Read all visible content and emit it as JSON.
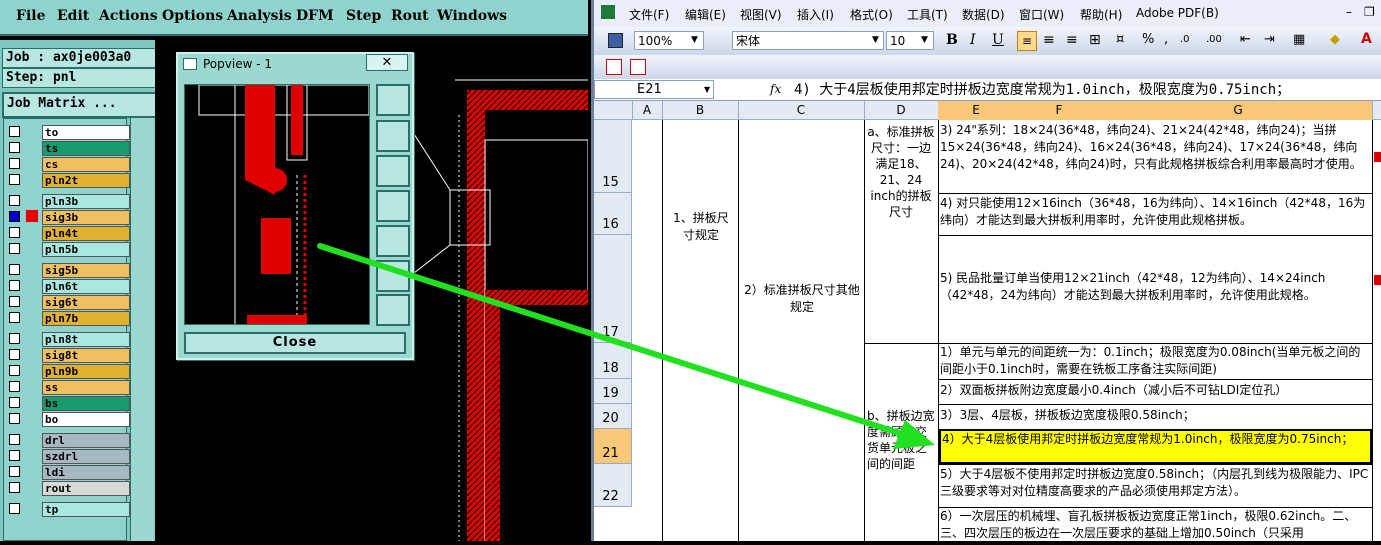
{
  "cam": {
    "menu": [
      "File",
      "Edit",
      "Actions",
      "Options",
      "Analysis",
      "DFM",
      "Step",
      "Rout",
      "Windows"
    ],
    "job": "Job : ax0je003a0",
    "step": "Step: pnl",
    "job_matrix": "Job Matrix ...",
    "layers": [
      {
        "name": "to",
        "color": "#ffffff",
        "on": false
      },
      {
        "name": "ts",
        "color": "#1a9a70",
        "on": false
      },
      {
        "name": "cs",
        "color": "#f0c060",
        "on": false
      },
      {
        "name": "pln2t",
        "color": "#e0b030",
        "on": false
      },
      {
        "name": "pln3b",
        "color": "#a8e8e0",
        "on": false
      },
      {
        "name": "sig3b",
        "color": "#f0c060",
        "on": true
      },
      {
        "name": "pln4t",
        "color": "#e0b030",
        "on": false
      },
      {
        "name": "pln5b",
        "color": "#a8e8e0",
        "on": false
      },
      {
        "name": "sig5b",
        "color": "#f0c060",
        "on": false
      },
      {
        "name": "pln6t",
        "color": "#a8e8e0",
        "on": false
      },
      {
        "name": "sig6t",
        "color": "#f0c060",
        "on": false
      },
      {
        "name": "pln7b",
        "color": "#e0b030",
        "on": false
      },
      {
        "name": "pln8t",
        "color": "#a8e8e0",
        "on": false
      },
      {
        "name": "sig8t",
        "color": "#f0c060",
        "on": false
      },
      {
        "name": "pln9b",
        "color": "#e0b030",
        "on": false
      },
      {
        "name": "ss",
        "color": "#f0c060",
        "on": false
      },
      {
        "name": "bs",
        "color": "#1a9a70",
        "on": false
      },
      {
        "name": "bo",
        "color": "#ffffff",
        "on": false
      },
      {
        "name": "drl",
        "color": "#a8b8c0",
        "on": false
      },
      {
        "name": "szdrl",
        "color": "#a8b8c0",
        "on": false
      },
      {
        "name": "ldi",
        "color": "#a8b8c0",
        "on": false
      },
      {
        "name": "rout",
        "color": "#d8d8d8",
        "on": false
      },
      {
        "name": "tp",
        "color": "#a8e8e0",
        "on": false
      }
    ],
    "popview": {
      "title": "Popview - 1",
      "close_label": "Close"
    }
  },
  "excel": {
    "menu": [
      "文件(F)",
      "编辑(E)",
      "视图(V)",
      "插入(I)",
      "格式(O)",
      "工具(T)",
      "数据(D)",
      "窗口(W)",
      "帮助(H)",
      "Adobe PDF(B)"
    ],
    "zoom": "100%",
    "font": "宋体",
    "font_size": "10",
    "name_box": "E21",
    "fx": "fx",
    "formula": "4) 大于4层板使用邦定时拼板边宽度常规为1.0inch，极限宽度为0.75inch；",
    "columns": [
      "A",
      "B",
      "C",
      "D",
      "E",
      "F",
      "G"
    ],
    "rows": [
      "15",
      "16",
      "17",
      "18",
      "19",
      "20",
      "21",
      "22"
    ],
    "b_merged": "1、拼板尺寸规定",
    "c_merged": "2）标准拼板尺寸其他规定",
    "d_a": "a、标准拼板尺寸：一边满足18、21、24 inch的拼板尺寸",
    "d_b": "b、拼板边宽度需顾客交货单元板之间的间距",
    "e15": "3) 24\"系列：18×24(36*48，纬向24)、21×24(42*48，纬向24)；当拼15×24(36*48，纬向24)、16×24(36*48，纬向24)、17×24(36*48，纬向24)、20×24(42*48，纬向24)时，只有此规格拼板综合利用率最高时才使用。",
    "e16": "4) 对只能使用12×16inch（36*48，16为纬向）、14×16inch（42*48，16为纬向）才能达到最大拼板利用率时，允许使用此规格拼板。",
    "e17": "5) 民品批量订单当使用12×21inch（42*48，12为纬向）、14×24inch（42*48，24为纬向）才能达到最大拼板利用率时，允许使用此规格。",
    "e18": "1）单元与单元的间距统一为：0.1inch；极限宽度为0.08inch(当单元板之间的间距小于0.1inch时，需要在铣板工序备注实际间距)",
    "e19": "2）双面板拼板附边宽度最小0.4inch（减小后不可钻LDI定位孔）",
    "e20": "3）3层、4层板，拼板板边宽度极限0.58inch；",
    "e21": "4）大于4层板使用邦定时拼板边宽度常规为1.0inch，极限宽度为0.75inch；",
    "e22": "5）大于4层板不使用邦定时拼板边宽度0.58inch；（内层孔到线为极限能力、IPC三级要求等对对位精度高要求的产品必须使用邦定方法）。",
    "e23": "6）一次层压的机械埋、盲孔板拼板板边宽度正常1inch，极限0.62inch。二、三、四次层压的板边在一次层压要求的基础上增加0.50inch（只采用"
  }
}
